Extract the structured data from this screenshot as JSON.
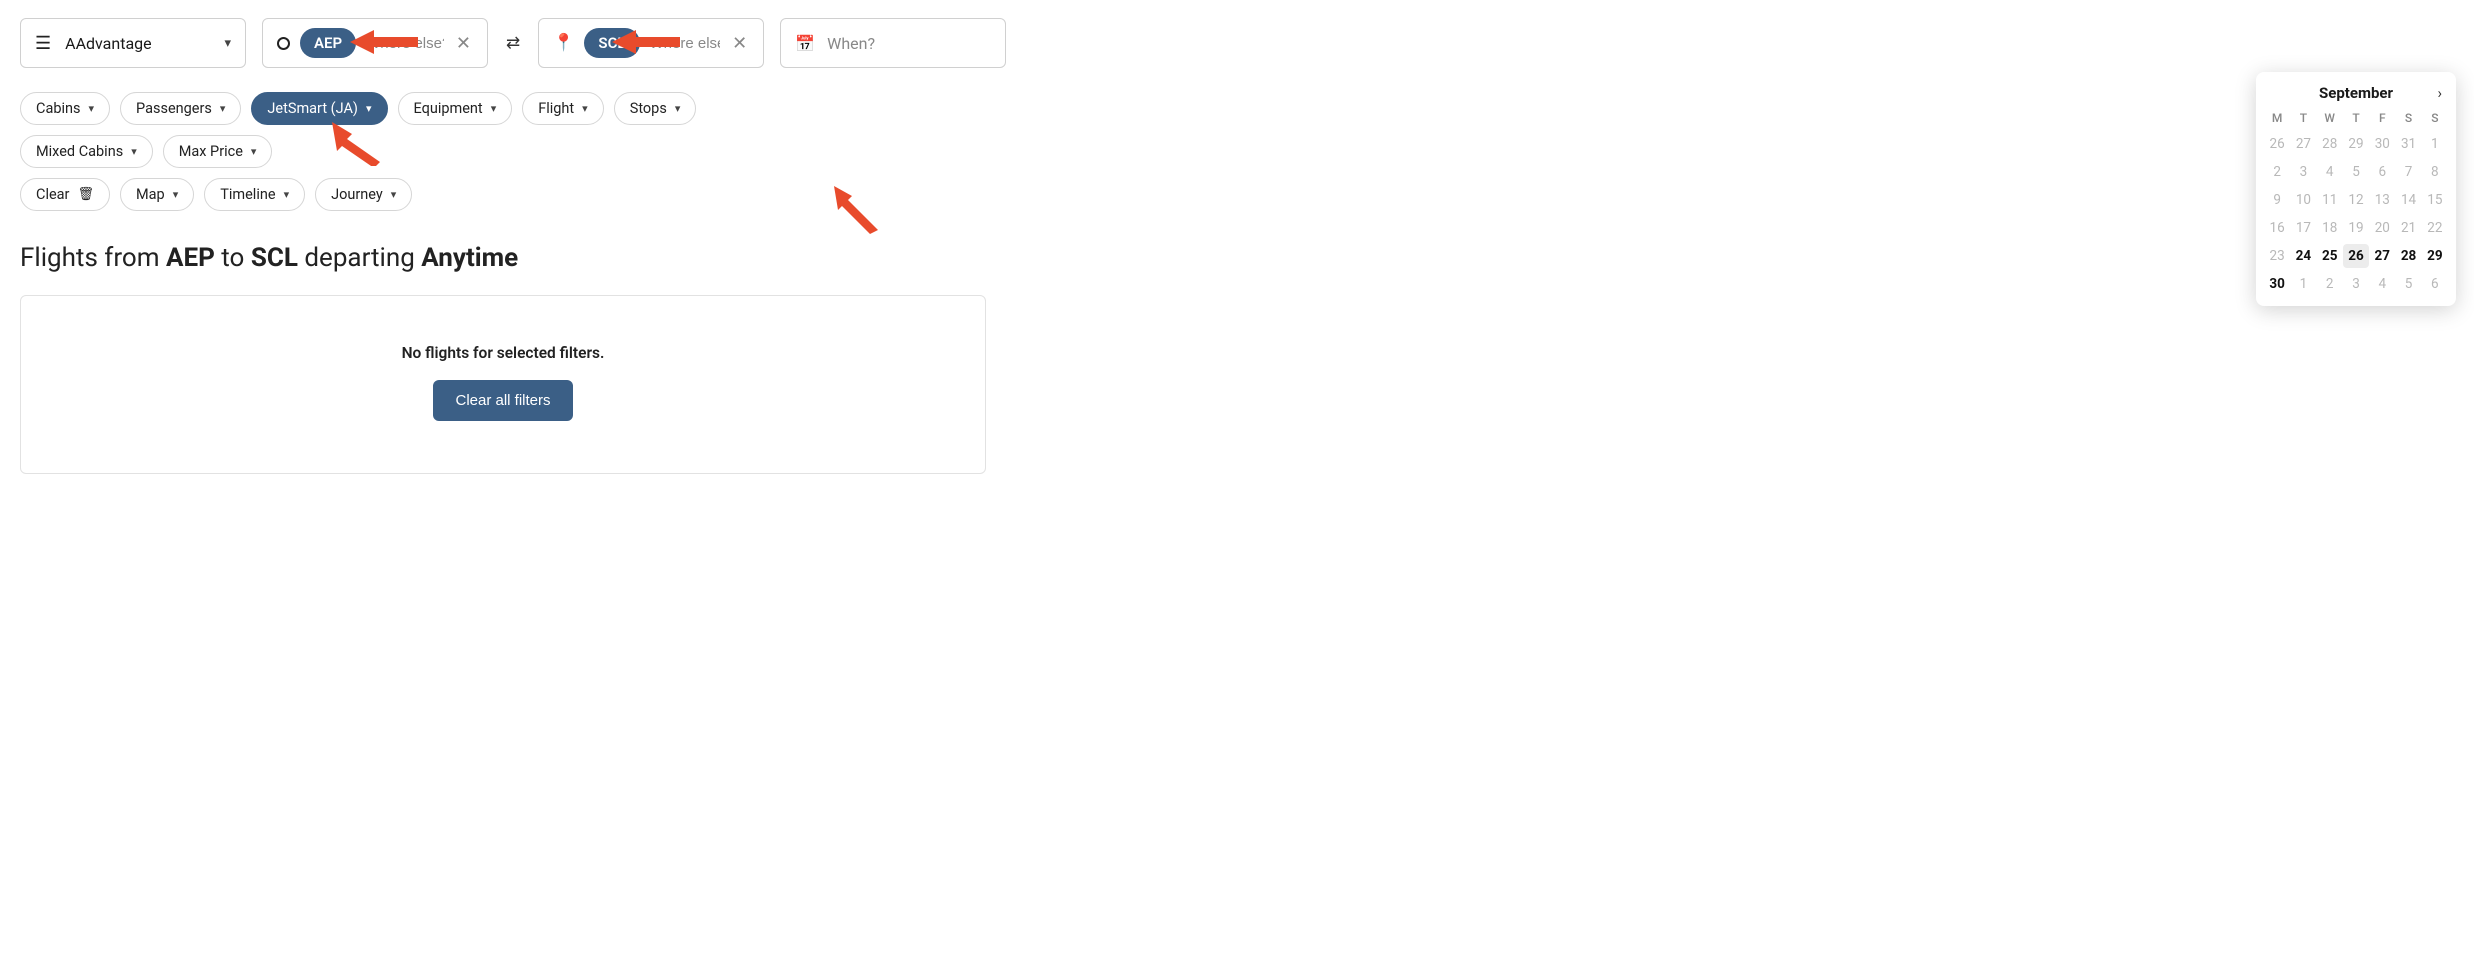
{
  "program": {
    "label": "AAdvantage"
  },
  "origin": {
    "code": "AEP",
    "placeholder": "Where else?"
  },
  "destination": {
    "code": "SCL",
    "placeholder": "Where else?"
  },
  "when": {
    "label": "When?"
  },
  "filters": {
    "row1": [
      {
        "label": "Cabins",
        "active": false
      },
      {
        "label": "Passengers",
        "active": false
      },
      {
        "label": "JetSmart (JA)",
        "active": true
      },
      {
        "label": "Equipment",
        "active": false
      },
      {
        "label": "Flight",
        "active": false
      },
      {
        "label": "Stops",
        "active": false
      },
      {
        "label": "Mixed Cabins",
        "active": false
      },
      {
        "label": "Max Price",
        "active": false
      }
    ],
    "row2": [
      {
        "label": "Clear",
        "icon": "trash"
      },
      {
        "label": "Map"
      },
      {
        "label": "Timeline"
      },
      {
        "label": "Journey"
      }
    ]
  },
  "heading": {
    "prefix": "Flights from ",
    "from": "AEP",
    "mid": " to ",
    "to": "SCL",
    "dep": " departing ",
    "time": "Anytime"
  },
  "results": {
    "empty_message": "No flights for selected filters.",
    "clear_button": "Clear all filters"
  },
  "calendar": {
    "month": "September",
    "dow": [
      "M",
      "T",
      "W",
      "T",
      "F",
      "S",
      "S"
    ],
    "days": [
      {
        "n": "26",
        "muted": true
      },
      {
        "n": "27",
        "muted": true
      },
      {
        "n": "28",
        "muted": true
      },
      {
        "n": "29",
        "muted": true
      },
      {
        "n": "30",
        "muted": true
      },
      {
        "n": "31",
        "muted": true
      },
      {
        "n": "1",
        "muted": true
      },
      {
        "n": "2",
        "muted": true
      },
      {
        "n": "3",
        "muted": true
      },
      {
        "n": "4",
        "muted": true
      },
      {
        "n": "5",
        "muted": true
      },
      {
        "n": "6",
        "muted": true
      },
      {
        "n": "7",
        "muted": true
      },
      {
        "n": "8",
        "muted": true
      },
      {
        "n": "9",
        "muted": true
      },
      {
        "n": "10",
        "muted": true
      },
      {
        "n": "11",
        "muted": true
      },
      {
        "n": "12",
        "muted": true
      },
      {
        "n": "13",
        "muted": true
      },
      {
        "n": "14",
        "muted": true
      },
      {
        "n": "15",
        "muted": true
      },
      {
        "n": "16",
        "muted": true
      },
      {
        "n": "17",
        "muted": true
      },
      {
        "n": "18",
        "muted": true
      },
      {
        "n": "19",
        "muted": true
      },
      {
        "n": "20",
        "muted": true
      },
      {
        "n": "21",
        "muted": true
      },
      {
        "n": "22",
        "muted": true
      },
      {
        "n": "23",
        "muted": true
      },
      {
        "n": "24",
        "bold": true
      },
      {
        "n": "25",
        "bold": true
      },
      {
        "n": "26",
        "bold": true,
        "today": true
      },
      {
        "n": "27",
        "bold": true
      },
      {
        "n": "28",
        "bold": true
      },
      {
        "n": "29",
        "bold": true
      },
      {
        "n": "30",
        "bold": true
      },
      {
        "n": "1",
        "muted": true
      },
      {
        "n": "2",
        "muted": true
      },
      {
        "n": "3",
        "muted": true
      },
      {
        "n": "4",
        "muted": true
      },
      {
        "n": "5",
        "muted": true
      },
      {
        "n": "6",
        "muted": true
      }
    ]
  }
}
